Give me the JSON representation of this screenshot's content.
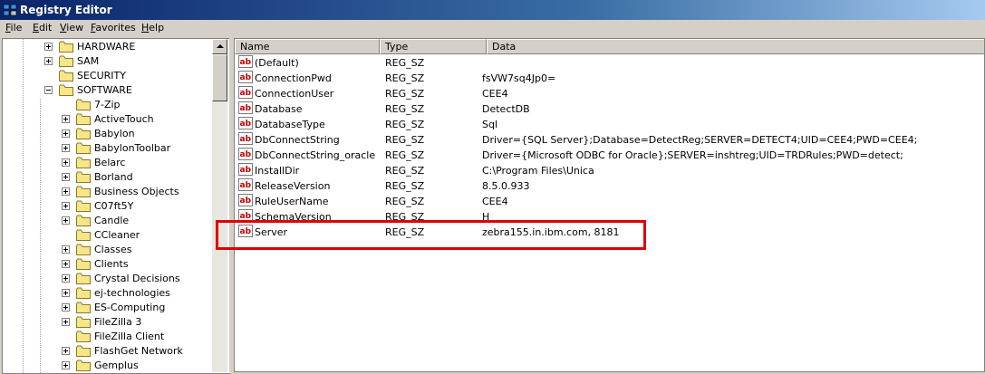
{
  "window": {
    "title": "Registry Editor",
    "icon": "registry-editor-icon"
  },
  "menu": [
    {
      "label": "File",
      "accel": "F",
      "rest": "ile"
    },
    {
      "label": "Edit",
      "accel": "E",
      "rest": "dit"
    },
    {
      "label": "View",
      "accel": "V",
      "rest": "iew"
    },
    {
      "label": "Favorites",
      "accel": "F",
      "rest": "avorites"
    },
    {
      "label": "Help",
      "accel": "H",
      "rest": "elp"
    }
  ],
  "tree": {
    "nodes": [
      {
        "label": "HARDWARE",
        "level": 1,
        "expander": "plus"
      },
      {
        "label": "SAM",
        "level": 1,
        "expander": "plus"
      },
      {
        "label": "SECURITY",
        "level": 1,
        "expander": "none"
      },
      {
        "label": "SOFTWARE",
        "level": 1,
        "expander": "minus"
      },
      {
        "label": "7-Zip",
        "level": 2,
        "expander": "none"
      },
      {
        "label": "ActiveTouch",
        "level": 2,
        "expander": "plus"
      },
      {
        "label": "Babylon",
        "level": 2,
        "expander": "plus"
      },
      {
        "label": "BabylonToolbar",
        "level": 2,
        "expander": "plus"
      },
      {
        "label": "Belarc",
        "level": 2,
        "expander": "plus"
      },
      {
        "label": "Borland",
        "level": 2,
        "expander": "plus"
      },
      {
        "label": "Business Objects",
        "level": 2,
        "expander": "plus"
      },
      {
        "label": "C07ft5Y",
        "level": 2,
        "expander": "plus"
      },
      {
        "label": "Candle",
        "level": 2,
        "expander": "plus"
      },
      {
        "label": "CCleaner",
        "level": 2,
        "expander": "none"
      },
      {
        "label": "Classes",
        "level": 2,
        "expander": "plus"
      },
      {
        "label": "Clients",
        "level": 2,
        "expander": "plus"
      },
      {
        "label": "Crystal Decisions",
        "level": 2,
        "expander": "plus"
      },
      {
        "label": "ej-technologies",
        "level": 2,
        "expander": "plus"
      },
      {
        "label": "ES-Computing",
        "level": 2,
        "expander": "plus"
      },
      {
        "label": "FileZilla 3",
        "level": 2,
        "expander": "plus"
      },
      {
        "label": "FileZilla Client",
        "level": 2,
        "expander": "none"
      },
      {
        "label": "FlashGet Network",
        "level": 2,
        "expander": "plus"
      },
      {
        "label": "Gemplus",
        "level": 2,
        "expander": "plus"
      }
    ]
  },
  "list": {
    "columns": [
      "Name",
      "Type",
      "Data"
    ],
    "value_icon": "string-value-icon",
    "rows": [
      {
        "name": "(Default)",
        "type": "REG_SZ",
        "data": ""
      },
      {
        "name": "ConnectionPwd",
        "type": "REG_SZ",
        "data": "fsVW7sq4Jp0="
      },
      {
        "name": "ConnectionUser",
        "type": "REG_SZ",
        "data": "CEE4"
      },
      {
        "name": "Database",
        "type": "REG_SZ",
        "data": "DetectDB"
      },
      {
        "name": "DatabaseType",
        "type": "REG_SZ",
        "data": "Sql"
      },
      {
        "name": "DbConnectString",
        "type": "REG_SZ",
        "data": "Driver={SQL Server};Database=DetectReg;SERVER=DETECT4;UID=CEE4;PWD=CEE4;"
      },
      {
        "name": "DbConnectString_oracle",
        "type": "REG_SZ",
        "data": "Driver={Microsoft ODBC for Oracle};SERVER=inshtreg;UID=TRDRules;PWD=detect;"
      },
      {
        "name": "InstallDir",
        "type": "REG_SZ",
        "data": "C:\\Program Files\\Unica"
      },
      {
        "name": "ReleaseVersion",
        "type": "REG_SZ",
        "data": "8.5.0.933"
      },
      {
        "name": "RuleUserName",
        "type": "REG_SZ",
        "data": "CEE4"
      },
      {
        "name": "SchemaVersion",
        "type": "REG_SZ",
        "data": "H"
      },
      {
        "name": "Server",
        "type": "REG_SZ",
        "data": "zebra155.in.ibm.com, 8181"
      }
    ]
  },
  "colors": {
    "title_start": "#0a246a",
    "title_end": "#a6caf0",
    "annotation": "#e00000",
    "folder": "#f7e58a"
  }
}
